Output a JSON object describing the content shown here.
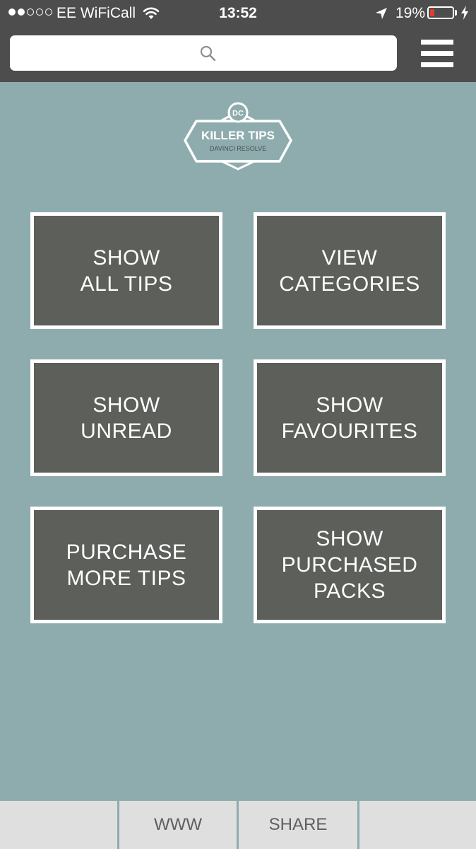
{
  "status_bar": {
    "carrier": "EE WiFiCall",
    "time": "13:52",
    "battery_percent": "19%",
    "battery_level": 0.19,
    "battery_color": "#e53935",
    "icons": [
      "signal-dots-icon",
      "wifi-icon",
      "location-arrow-icon",
      "battery-icon",
      "charging-bolt-icon"
    ]
  },
  "header": {
    "search_placeholder": "",
    "search_icon": "search-icon",
    "menu_icon": "hamburger-menu-icon",
    "background_color": "#4d4d4d"
  },
  "logo": {
    "badge": "DC",
    "title": "KILLER TIPS",
    "subtitle": "DAVINCI RESOLVE"
  },
  "tiles": [
    {
      "lines": [
        "SHOW",
        "ALL TIPS"
      ]
    },
    {
      "lines": [
        "VIEW",
        "CATEGORIES"
      ]
    },
    {
      "lines": [
        "SHOW",
        "UNREAD"
      ]
    },
    {
      "lines": [
        "SHOW",
        "FAVOURITES"
      ]
    },
    {
      "lines": [
        "PURCHASE",
        "MORE TIPS"
      ]
    },
    {
      "lines": [
        "SHOW",
        "PURCHASED",
        "PACKS"
      ]
    }
  ],
  "bottom_bar": {
    "tabs": [
      "",
      "WWW",
      "SHARE",
      ""
    ]
  },
  "colors": {
    "background": "#8eacae",
    "tile": "#5c5f5a",
    "tile_border": "#ffffff",
    "bottom_bar": "#dfdfdf"
  }
}
